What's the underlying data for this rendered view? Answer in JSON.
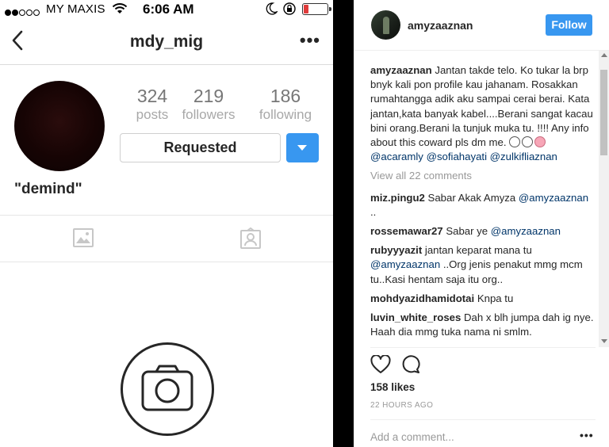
{
  "status_bar": {
    "carrier": "MY MAXIS",
    "time": "6:06 AM",
    "signal_dots": [
      true,
      true,
      false,
      false,
      false
    ]
  },
  "profile": {
    "username": "mdy_mig",
    "stats": [
      {
        "value": "324",
        "label": "posts"
      },
      {
        "value": "219",
        "label": "followers"
      },
      {
        "value": "186",
        "label": "following"
      }
    ],
    "requested_label": "Requested",
    "bio_name": "\"demind\""
  },
  "post": {
    "author": "amyzaaznan",
    "follow_label": "Follow",
    "caption_user": "amyzaaznan",
    "caption_text": " Jantan takde telo. Ko tukar la brp bnyk kali pon profile kau jahanam. Rosakkan rumahtangga adik aku sampai cerai berai. Kata jantan,kata banyak kabel....Berani sangat kacau bini orang.Berani la tunjuk muka tu. !!!! Any info about this coward pls dm me. ",
    "caption_mentions": [
      "@acaramly",
      "@sofiahayati",
      "@zulkifliaznan"
    ],
    "view_all": "View all 22 comments",
    "comments": [
      {
        "user": "miz.pingu2",
        "text": " Sabar Akak Amyza ",
        "mention": "@amyzaaznan",
        "after": " .."
      },
      {
        "user": "rossemawar27",
        "text": " Sabar ye ",
        "mention": "@amyzaaznan",
        "after": ""
      },
      {
        "user": "rubyyyazit",
        "text": " jantan keparat mana tu ",
        "mention": "@amyzaaznan",
        "after": " ..Org jenis penakut mmg mcm tu..Kasi hentam saja itu org.."
      },
      {
        "user": "mohdyazidhamidotai",
        "text": " Knpa tu",
        "mention": "",
        "after": ""
      },
      {
        "user": "luvin_white_roses",
        "text": " Dah x blh jumpa dah ig nye. Haah dia mmg tuka nama ni smlm.",
        "mention": "",
        "after": ""
      }
    ],
    "likes": "158 likes",
    "time_ago": "22 HOURS AGO",
    "add_comment_placeholder": "Add a comment...",
    "more_label": "•••"
  },
  "colors": {
    "accent": "#3897f0",
    "mention": "#003569",
    "battery_low": "#e03c3c"
  },
  "icons": [
    "wifi-icon",
    "moon-icon",
    "orientation-lock-icon",
    "battery-icon",
    "back-chevron-icon",
    "more-options-icon",
    "dropdown-caret-icon",
    "grid-photo-icon",
    "tagged-user-icon",
    "camera-icon",
    "heart-icon",
    "comment-bubble-icon"
  ]
}
